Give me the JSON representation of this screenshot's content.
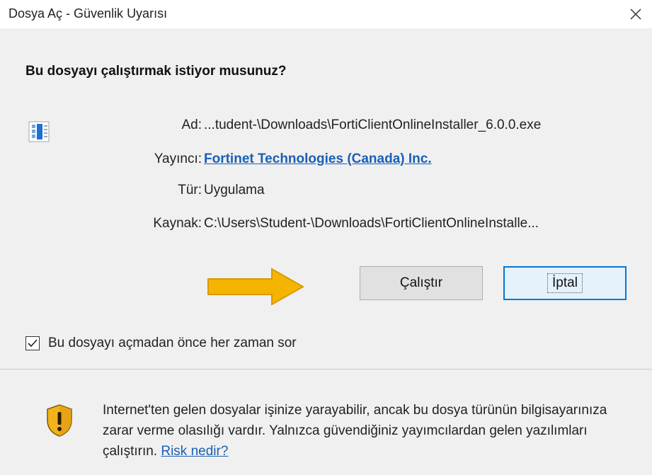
{
  "window": {
    "title": "Dosya Aç - Güvenlik Uyarısı",
    "close_icon": "close-icon"
  },
  "dialog": {
    "question": "Bu dosyayı çalıştırmak istiyor musunuz?",
    "fields": [
      {
        "label": "Ad:",
        "value": "...tudent-\\Downloads\\FortiClientOnlineInstaller_6.0.0.exe"
      },
      {
        "label": "Yayıncı:",
        "value": "Fortinet Technologies (Canada) Inc."
      },
      {
        "label": "Tür:",
        "value": "Uygulama"
      },
      {
        "label": "Kaynak:",
        "value": "C:\\Users\\Student-\\Downloads\\FortiClientOnlineInstalle..."
      }
    ],
    "buttons": {
      "run": "Çalıştır",
      "cancel": "İptal"
    },
    "checkbox": {
      "label": "Bu dosyayı açmadan önce her zaman sor",
      "checked": true
    },
    "warning": {
      "text": "Internet'ten gelen dosyalar işinize yarayabilir, ancak bu dosya türünün bilgisayarınıza zarar verme olasılığı vardır. Yalnızca güvendiğiniz yayımcılardan gelen yazılımları çalıştırın.",
      "link": "Risk nedir?"
    }
  },
  "colors": {
    "link": "#1a5fb4",
    "arrow": "#f5b400",
    "focus_border": "#0078d7"
  }
}
